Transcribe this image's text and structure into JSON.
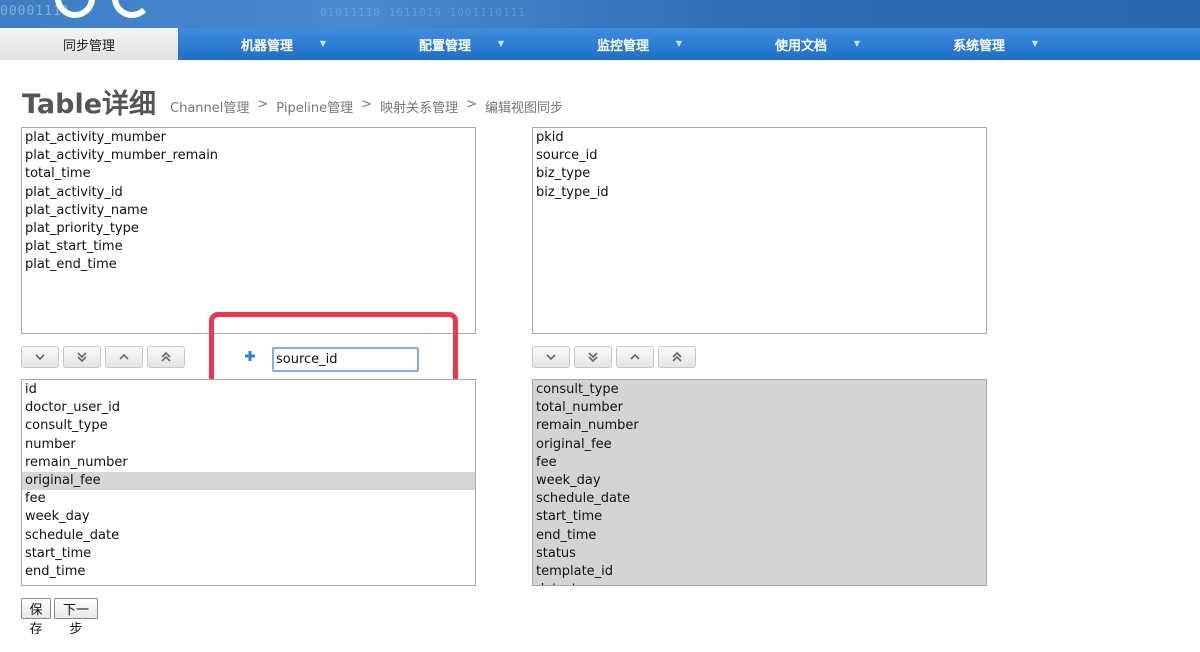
{
  "banner": {
    "binary_text": "00001111",
    "binary_text_2": "01011110 1611019 1001110111"
  },
  "nav": {
    "items": [
      {
        "label": "同步管理",
        "active": true
      },
      {
        "label": "机器管理",
        "active": false
      },
      {
        "label": "配置管理",
        "active": false
      },
      {
        "label": "监控管理",
        "active": false
      },
      {
        "label": "使用文档",
        "active": false
      },
      {
        "label": "系统管理",
        "active": false
      }
    ]
  },
  "page": {
    "title": "Table详细",
    "breadcrumb": [
      "Channel管理",
      "Pipeline管理",
      "映射关系管理",
      "编辑视图同步"
    ],
    "breadcrumb_sep": ">"
  },
  "lists": {
    "left_top": [
      "plat_activity_mumber",
      "plat_activity_mumber_remain",
      "total_time",
      "plat_activity_id",
      "plat_activity_name",
      "plat_priority_type",
      "plat_start_time",
      "plat_end_time"
    ],
    "right_top": [
      "pkid",
      "source_id",
      "biz_type",
      "biz_type_id"
    ],
    "left_bottom": [
      "id",
      "doctor_user_id",
      "consult_type",
      "number",
      "remain_number",
      "original_fee",
      "fee",
      "week_day",
      "schedule_date",
      "start_time",
      "end_time"
    ],
    "left_bottom_selected": "original_fee",
    "right_bottom": [
      "consult_type",
      "total_number",
      "remain_number",
      "original_fee",
      "fee",
      "week_day",
      "schedule_date",
      "start_time",
      "end_time",
      "status",
      "template_id",
      "data_type"
    ]
  },
  "field_input": {
    "value": "source_id"
  },
  "buttons": {
    "save": "保存",
    "next": "下一步"
  },
  "icons": {
    "move_buttons": [
      "chevron-down-icon",
      "double-chevron-down-icon",
      "chevron-up-icon",
      "double-chevron-up-icon"
    ],
    "add": "plus-icon"
  },
  "colors": {
    "nav_blue": "#2a76cf",
    "highlight_red": "#f0354f",
    "input_border": "#7fb0e8",
    "plus_blue": "#2b7fd8"
  }
}
